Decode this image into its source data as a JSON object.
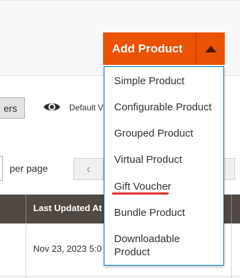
{
  "header": {
    "add_product_label": "Add Product",
    "accent_color": "#eb5202"
  },
  "toolbar": {
    "filters_label": "ers",
    "default_view_label": "Default View",
    "per_page_label": "per page",
    "prev_icon": "‹"
  },
  "table": {
    "columns": [
      "Last Updated At"
    ],
    "rows": [
      {
        "last_updated": "Nov 23, 2023 5:06"
      }
    ]
  },
  "dropdown": {
    "items": [
      {
        "label": "Simple Product"
      },
      {
        "label": "Configurable Product"
      },
      {
        "label": "Grouped Product"
      },
      {
        "label": "Virtual Product"
      },
      {
        "label": "Gift Voucher"
      },
      {
        "label": "Bundle Product"
      },
      {
        "label": "Downloadable Product"
      }
    ]
  }
}
